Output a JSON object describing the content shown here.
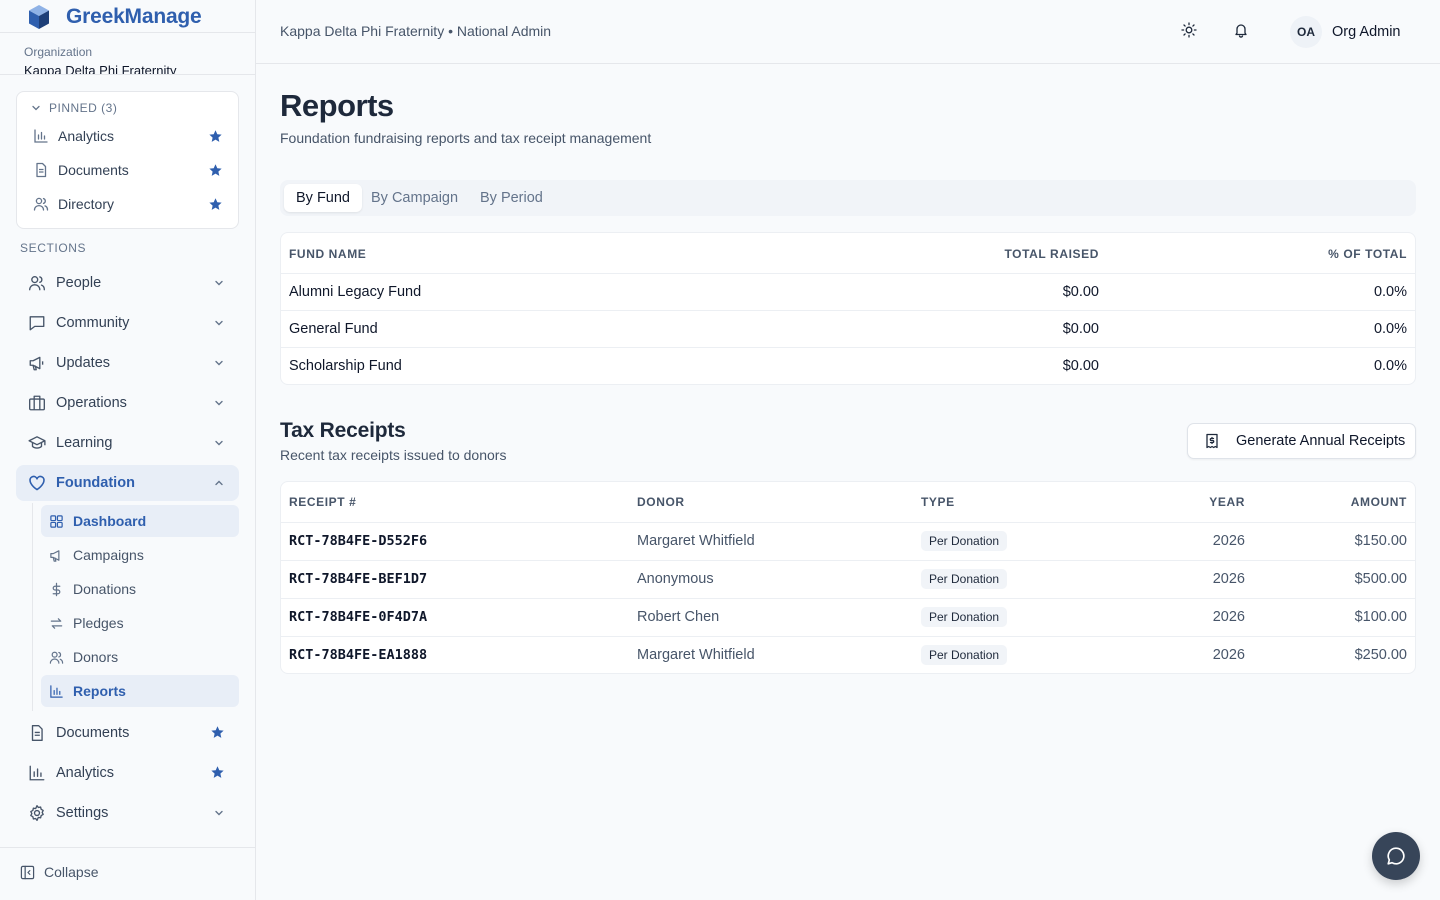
{
  "brand": {
    "name": "GreekManage",
    "logo_icon": "cube-logo-icon"
  },
  "organization": {
    "label": "Organization",
    "name": "Kappa Delta Phi Fraternity"
  },
  "pinned": {
    "header": "PINNED (3)",
    "items": [
      {
        "label": "Analytics",
        "icon": "bar-chart-icon"
      },
      {
        "label": "Documents",
        "icon": "document-icon"
      },
      {
        "label": "Directory",
        "icon": "users-icon"
      }
    ]
  },
  "sections": {
    "label": "SECTIONS",
    "items": [
      {
        "label": "People",
        "icon": "users-icon"
      },
      {
        "label": "Community",
        "icon": "chat-icon"
      },
      {
        "label": "Updates",
        "icon": "megaphone-icon"
      },
      {
        "label": "Operations",
        "icon": "building-icon"
      },
      {
        "label": "Learning",
        "icon": "graduation-cap-icon"
      },
      {
        "label": "Foundation",
        "icon": "heart-icon"
      },
      {
        "label": "Documents",
        "icon": "document-icon"
      },
      {
        "label": "Analytics",
        "icon": "bar-chart-icon"
      },
      {
        "label": "Settings",
        "icon": "gear-icon"
      }
    ],
    "foundation_sub": [
      {
        "label": "Dashboard",
        "icon": "grid-icon"
      },
      {
        "label": "Campaigns",
        "icon": "megaphone-icon"
      },
      {
        "label": "Donations",
        "icon": "dollar-icon"
      },
      {
        "label": "Pledges",
        "icon": "swap-icon"
      },
      {
        "label": "Donors",
        "icon": "users-icon"
      },
      {
        "label": "Reports",
        "icon": "bar-chart-icon"
      }
    ]
  },
  "collapse_label": "Collapse",
  "header": {
    "breadcrumb": "Kappa Delta Phi Fraternity • National Admin",
    "avatar_initials": "OA",
    "user_name": "Org Admin"
  },
  "page": {
    "title": "Reports",
    "subtitle": "Foundation fundraising reports and tax receipt management"
  },
  "tabs": [
    "By Fund",
    "By Campaign",
    "By Period"
  ],
  "fund_table": {
    "headers": [
      "FUND NAME",
      "TOTAL RAISED",
      "% OF TOTAL"
    ],
    "rows": [
      [
        "Alumni Legacy Fund",
        "$0.00",
        "0.0%"
      ],
      [
        "General Fund",
        "$0.00",
        "0.0%"
      ],
      [
        "Scholarship Fund",
        "$0.00",
        "0.0%"
      ]
    ]
  },
  "tax_receipts": {
    "title": "Tax Receipts",
    "subtitle": "Recent tax receipts issued to donors",
    "button_label": "Generate Annual Receipts",
    "headers": [
      "RECEIPT #",
      "DONOR",
      "TYPE",
      "YEAR",
      "AMOUNT"
    ],
    "rows": [
      [
        "RCT-78B4FE-D552F6",
        "Margaret Whitfield",
        "Per Donation",
        "2026",
        "$150.00"
      ],
      [
        "RCT-78B4FE-BEF1D7",
        "Anonymous",
        "Per Donation",
        "2026",
        "$500.00"
      ],
      [
        "RCT-78B4FE-0F4D7A",
        "Robert Chen",
        "Per Donation",
        "2026",
        "$100.00"
      ],
      [
        "RCT-78B4FE-EA1888",
        "Margaret Whitfield",
        "Per Donation",
        "2026",
        "$250.00"
      ]
    ]
  },
  "colors": {
    "accent": "#2f5fae",
    "fab": "#374559"
  }
}
